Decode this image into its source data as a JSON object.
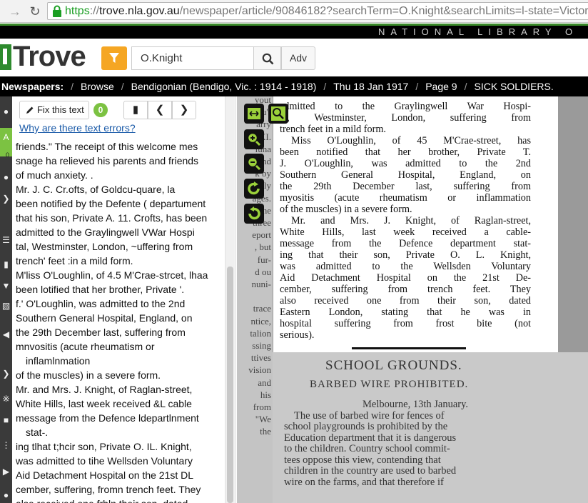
{
  "browser": {
    "url_https": "https",
    "url_sep": "://",
    "url_host": "trove.nla.gov.au",
    "url_path": "/newspaper/article/90846182?searchTerm=O.Knight&searchLimits=l-state=Victor"
  },
  "nla_banner": "NATIONAL LIBRARY O",
  "header": {
    "logo": "Trove",
    "search_value": "O.Knight",
    "adv_label": "Adv"
  },
  "breadcrumb": {
    "head": "Newspapers:",
    "items": [
      "Browse",
      "Bendigonian (Bendigo, Vic. : 1914 - 1918)",
      "Thu 18 Jan 1917",
      "Page 9",
      "SICK SOLDIERS."
    ]
  },
  "left_toolbar": {
    "active_count": "0"
  },
  "text_pane": {
    "fix_label": "Fix this text",
    "fix_count": "0",
    "errors_link": "Why are there text errors?",
    "lines": [
      "friends.\" The receipt of this welcome mes",
      "snage ha relieved his parents and friends",
      "of much anxiety. .",
      "Mr. J. C. Cr.ofts, of Goldcu-quare, la",
      "been notified by the Defente ( departument",
      "that his son, Private A. 11. Crofts, has been",
      "admitted to the Graylingwell VWar Hospi",
      "tal, Westminster, London, ~uffering from",
      "trench' feet :in a mild form.",
      "M'liss O'Loughlin, of 4.5 M'Crae-strcet, lhaa",
      "been lotified that her brother, Private '.",
      "f.' O'Loughlin, was admitted to the 2nd",
      "Southern General Hospital, England, on",
      "the 29th December last, suffering from",
      "mnvositis (acute rheumatism or",
      "inflamlnmation",
      "of the muscles) in a severe form.",
      "Mr. and Mrs. J. Knight, of Raglan-street,",
      "White Hills, last week received &L cable",
      "message from the Defence ldepartlnment",
      "stat-.",
      "ing tlhat t;hcir son, Private O. IL. Knight,",
      "was admitted to tihe Wellsden Voluntary",
      "Aid Detachment Hospital on the 21st DL",
      "cember, suffering, fromn trench feet. They",
      "also received one frbln their son, dated"
    ]
  },
  "image_pane": {
    "strip_lines": [
      "yout",
      "you'r",
      "arry",
      "y. XI.",
      "luna",
      "and",
      "k by",
      "ently",
      "ages.",
      "the",
      "three",
      "eport",
      ", but",
      "fur-",
      "d ou",
      "nuni-",
      "",
      "trace",
      "ntice,",
      "talion",
      "ssing",
      "ttives",
      "vision",
      "and",
      "his",
      "from",
      "\"We",
      "the"
    ],
    "article_lines": [
      "admitted to the Graylingwell War Hospi-",
      "al, Westminster, London, suffering from",
      "trench feet in a mild form.",
      "Miss O'Loughlin, of 45 M'Crae-street, has",
      "been notified that her brother, Private T.",
      "J. O'Loughlin, was admitted to the 2nd",
      "Southern General Hospital, England, on",
      "the 29th December last, suffering from",
      "myositis (acute rheumatism or inflammation",
      "of the muscles) in a severe form.",
      "Mr. and Mrs. J. Knight, of Raglan-street,",
      "White Hills, last week received a cable-",
      "message from the Defence department stat-",
      "ing that their son, Private O. L. Knight,",
      "was admitted to the Wellsden Voluntary",
      "Aid Detachment Hospital on the 21st De-",
      "cember, suffering from trench feet. They",
      "also received one from their son, dated",
      "Eastern London, stating that he was in",
      "hospital suffering from frost bite (not",
      "serious)."
    ],
    "school_heading": "SCHOOL GROUNDS.",
    "school_sub": "BARBED WIRE PROHIBITED.",
    "school_lines": [
      "Melbourne, 13th January.",
      "The use of barbed wire for fences of",
      "school playgrounds is prohibited by the",
      "Education department that it is dangerous",
      "to the children. Country school commit-",
      "tees oppose this view, contending that",
      "children in the country are used to barbed",
      "wire on the farms, and that therefore if"
    ]
  }
}
